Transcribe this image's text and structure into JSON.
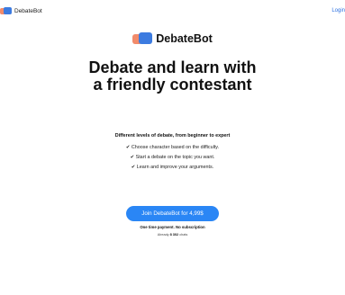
{
  "header": {
    "brand_name": "DebateBot",
    "login_label": "Login"
  },
  "hero": {
    "brand_name": "DebateBot",
    "headline_line1": "Debate and learn with",
    "headline_line2": "a friendly contestant"
  },
  "features": {
    "title": "Different levels of debate, from beginner to expert",
    "items": [
      "✔ Choose character based on the difficulty.",
      "✔ Start a debate on the topic you want.",
      "✔ Learn and improve your arguments."
    ]
  },
  "cta": {
    "button_label": "Join DebateBot for 4,99$",
    "payment_note": "One time payment. No subscription",
    "chats_prefix": "Already",
    "chats_count": "8 302",
    "chats_suffix": "chats"
  },
  "colors": {
    "accent": "#2a86f5",
    "logo_blue": "#3c7be0",
    "logo_orange": "#f28b6b"
  }
}
